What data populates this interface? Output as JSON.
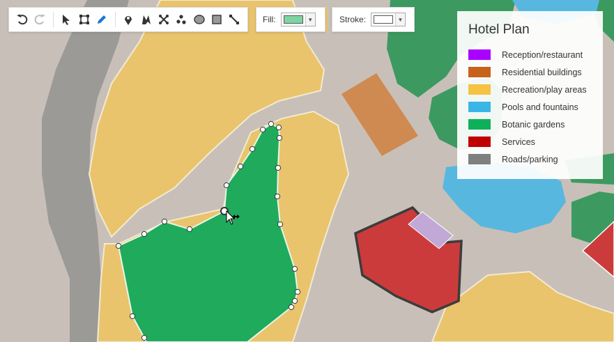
{
  "toolbar": {
    "tools": [
      {
        "name": "undo-icon",
        "interactable": true
      },
      {
        "name": "redo-icon",
        "interactable": false
      },
      {
        "name": "select-icon",
        "interactable": true
      },
      {
        "name": "transform-icon",
        "interactable": true
      },
      {
        "name": "pencil-icon",
        "interactable": true
      },
      {
        "name": "marker-icon",
        "interactable": true
      },
      {
        "name": "freehand-icon",
        "interactable": true
      },
      {
        "name": "connector-icon",
        "interactable": true
      },
      {
        "name": "scatter-icon",
        "interactable": true
      },
      {
        "name": "ellipse-icon",
        "interactable": true
      },
      {
        "name": "rectangle-icon",
        "interactable": true
      },
      {
        "name": "line-icon",
        "interactable": true
      }
    ],
    "active_tool": "pencil-icon"
  },
  "fill": {
    "label": "Fill:",
    "color": "#7ed4a3"
  },
  "stroke": {
    "label": "Stroke:",
    "color": "#ffffff"
  },
  "legend": {
    "title": "Hotel Plan",
    "items": [
      {
        "label": "Reception/restaurant",
        "color": "#aa00ff"
      },
      {
        "label": "Residential buildings",
        "color": "#c8611a"
      },
      {
        "label": "Recreation/play areas",
        "color": "#f6c243"
      },
      {
        "label": "Pools and fountains",
        "color": "#3ab5e6"
      },
      {
        "label": "Botanic gardens",
        "color": "#0eb05a"
      },
      {
        "label": "Services",
        "color": "#c00000"
      },
      {
        "label": "Roads/parking",
        "color": "#7f7f7f"
      }
    ]
  },
  "colors": {
    "ground": "#c8c0b8",
    "road": "#9c9a97",
    "recreation": "#e9c46c",
    "garden": "#1faa5c",
    "garden_dark": "#3c9a60",
    "pool": "#58b7df",
    "residential": "#cf8a52",
    "services": "#cc3b3b",
    "reception": "#c2a8d6"
  }
}
